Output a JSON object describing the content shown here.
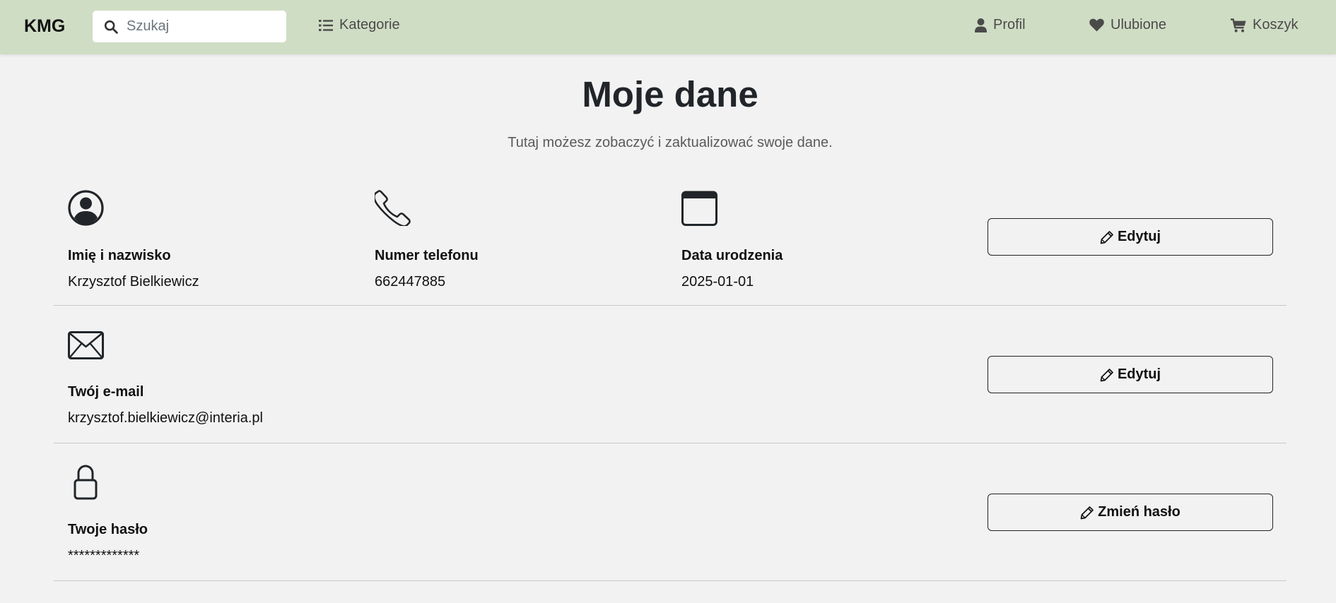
{
  "navbar": {
    "brand": "KMG",
    "search_placeholder": "Szukaj",
    "categories_label": "Kategorie",
    "profile_label": "Profil",
    "favorites_label": "Ulubione",
    "cart_label": "Koszyk"
  },
  "page": {
    "title": "Moje dane",
    "subtitle": "Tutaj możesz zobaczyć i zaktualizować swoje dane."
  },
  "personal": {
    "name_label": "Imię i nazwisko",
    "name_value": "Krzysztof Bielkiewicz",
    "phone_label": "Numer telefonu",
    "phone_value": "662447885",
    "birthdate_label": "Data urodzenia",
    "birthdate_value": "2025-01-01",
    "edit_label": "Edytuj"
  },
  "email": {
    "label": "Twój e-mail",
    "value": "krzysztof.bielkiewicz@interia.pl",
    "edit_label": "Edytuj"
  },
  "password": {
    "label": "Twoje hasło",
    "value": "*************",
    "change_label": "Zmień hasło"
  },
  "icons": {
    "search": "search-icon",
    "categories": "list-icon",
    "profile": "user-icon",
    "favorites": "heart-icon",
    "cart": "cart-icon",
    "name": "person-circle-icon",
    "phone": "telephone-icon",
    "birthdate": "calendar-icon",
    "email": "envelope-icon",
    "password": "lock-icon",
    "edit": "pencil-icon"
  },
  "colors": {
    "navbar_bg": "#d0ddc5",
    "page_bg": "#f2f2f2",
    "text": "#212529"
  }
}
